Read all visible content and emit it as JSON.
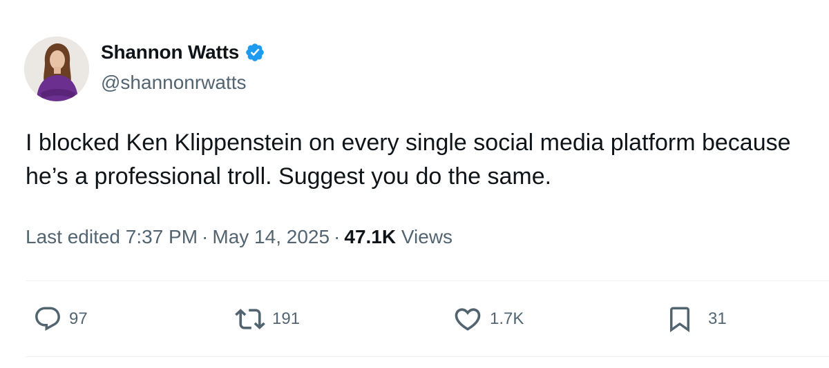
{
  "author": {
    "display_name": "Shannon Watts",
    "handle": "@shannonrwatts",
    "verified": true
  },
  "tweet": {
    "text": "I blocked Ken Klippenstein on every single social media platform because he’s a professional troll. Suggest you do the same."
  },
  "meta": {
    "edited_label": "Last edited 7:37 PM",
    "separator": "·",
    "date": "May 14, 2025",
    "views_count": "47.1K",
    "views_label": "Views"
  },
  "actions": {
    "replies": "97",
    "reposts": "191",
    "likes": "1.7K",
    "bookmarks": "31"
  },
  "colors": {
    "text_primary": "#0f1419",
    "text_secondary": "#536471",
    "verified_blue": "#1d9bf0",
    "divider": "#eff3f4"
  },
  "icons": {
    "verified": "verified-badge-icon",
    "reply": "reply-icon",
    "repost": "repost-icon",
    "like": "heart-icon",
    "bookmark": "bookmark-icon"
  }
}
